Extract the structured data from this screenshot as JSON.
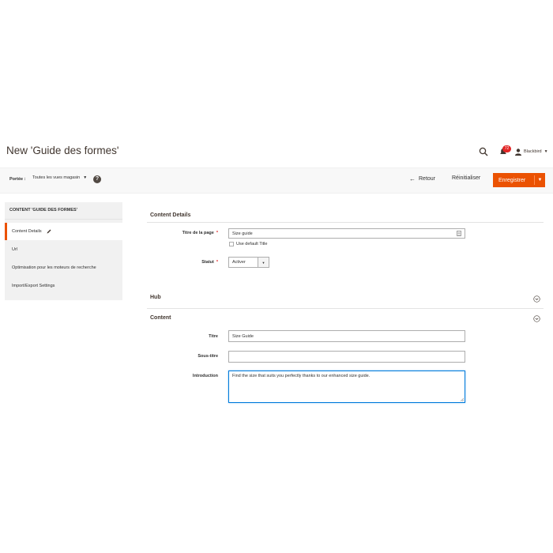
{
  "header": {
    "title": "New 'Guide des formes'",
    "notification_count": "72",
    "user_name": "Blackbird"
  },
  "scope": {
    "label": "Portée :",
    "value": "Toutes les vues magasin"
  },
  "actions": {
    "back_label": "Retour",
    "reset_label": "Réinitialiser",
    "save_label": "Enregistrer"
  },
  "sidebar": {
    "title": "CONTENT 'GUIDE DES FORMES'",
    "items": [
      {
        "label": "Content Details"
      },
      {
        "label": "Url"
      },
      {
        "label": "Optimisation pour les moteurs de recherche"
      },
      {
        "label": "Import/Export Settings"
      }
    ]
  },
  "content_details": {
    "title": "Content Details",
    "page_title_label": "Titre de la page",
    "page_title_value": "Size guide",
    "use_default_label": "Use default Title",
    "status_label": "Statut",
    "status_value": "Activer"
  },
  "hub": {
    "title": "Hub"
  },
  "content": {
    "title": "Content",
    "titre_label": "Titre",
    "titre_value": "Size Guide",
    "subtitle_label": "Sous-titre",
    "subtitle_value": "",
    "intro_label": "Introduction",
    "intro_value": "Find the size that suits you perfectly thanks to our enhanced size guide."
  },
  "colors": {
    "accent": "#eb5202",
    "badge": "#e22626",
    "focus": "#007bdb"
  }
}
